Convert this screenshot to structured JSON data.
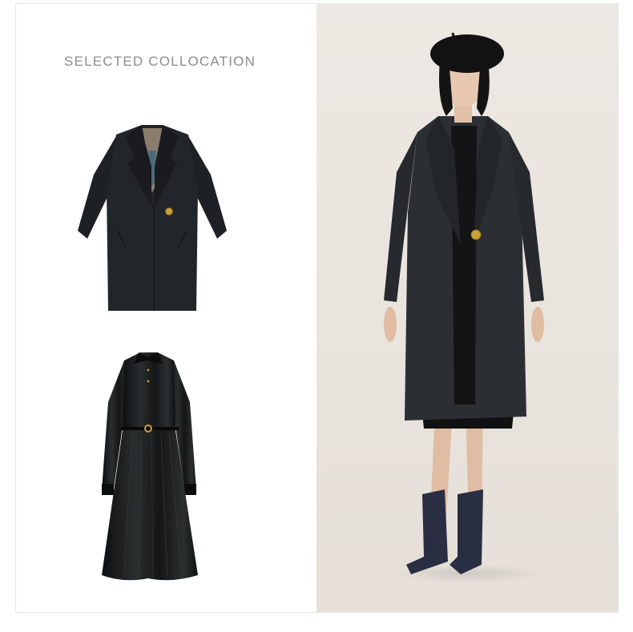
{
  "heading": "SELECTED COLLOCATION",
  "products": [
    {
      "name": "coat",
      "icon": "coat-image"
    },
    {
      "name": "dress",
      "icon": "velvet-dress-image"
    }
  ],
  "model_photo": {
    "icon": "model-photo"
  },
  "colors": {
    "heading_text": "#8c8c8c",
    "backdrop": "#ebe6e0",
    "coat": "#1f2227",
    "dress": "#16181a",
    "button_gold": "#c9a03a"
  }
}
